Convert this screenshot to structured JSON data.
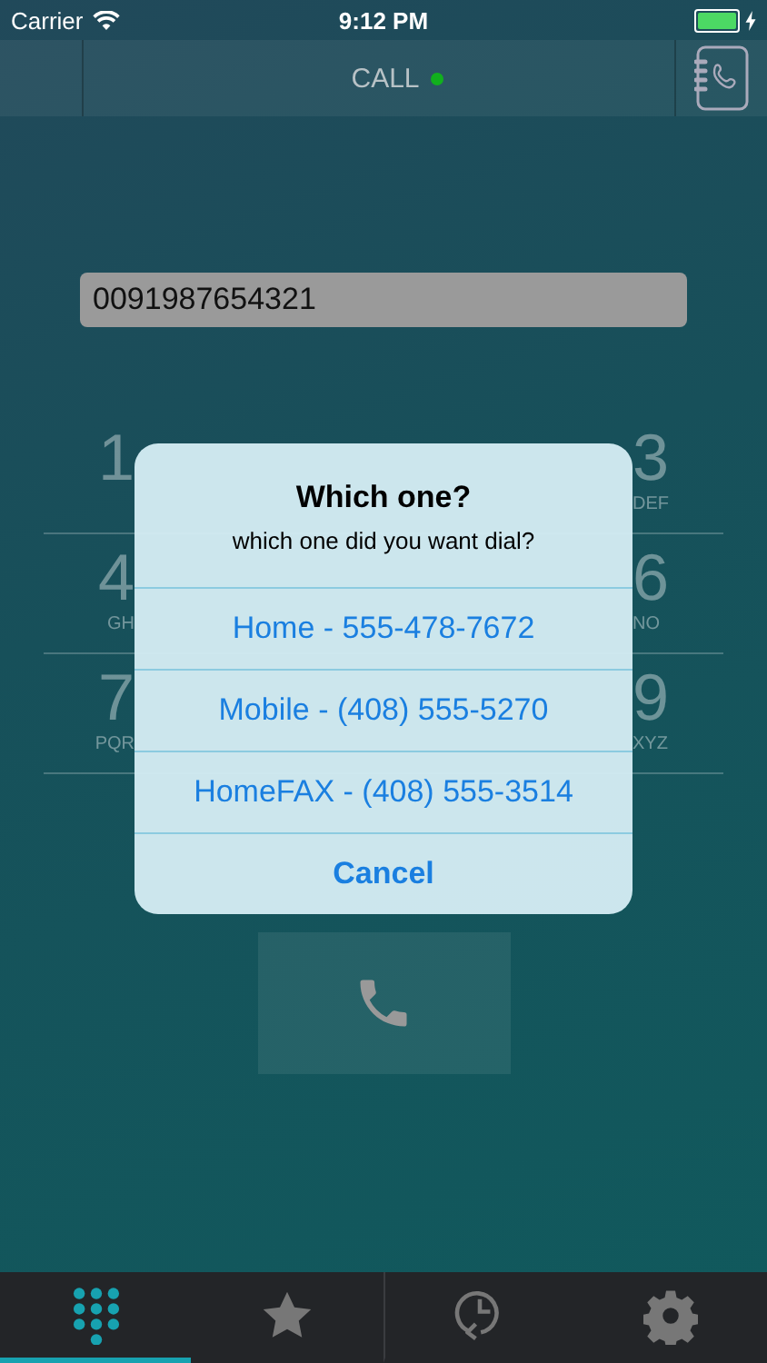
{
  "status_bar": {
    "carrier": "Carrier",
    "time": "9:12 PM",
    "charging": true
  },
  "nav_bar": {
    "title": "CALL",
    "online": true
  },
  "number_field": {
    "value": "0091987654321"
  },
  "keypad_rows": [
    {
      "left": {
        "digit": "1"
      },
      "right": {
        "digit": "3",
        "letters": "DEF"
      }
    },
    {
      "left": {
        "digit": "4",
        "letters": "GH"
      },
      "right": {
        "digit": "6",
        "letters": "NO"
      }
    },
    {
      "left": {
        "digit": "7",
        "letters": "PQR"
      },
      "right": {
        "digit": "9",
        "letters": "XYZ"
      }
    }
  ],
  "alert": {
    "title": "Which one?",
    "message": "which one did you want dial?",
    "options": [
      "Home - 555-478-7672",
      "Mobile - (408) 555-5270",
      "HomeFAX - (408) 555-3514"
    ],
    "cancel": "Cancel"
  },
  "tabs": [
    {
      "kind": "keypad",
      "selected": true
    },
    {
      "kind": "favorites",
      "selected": false
    },
    {
      "kind": "recents",
      "selected": false
    },
    {
      "kind": "settings",
      "selected": false
    }
  ]
}
